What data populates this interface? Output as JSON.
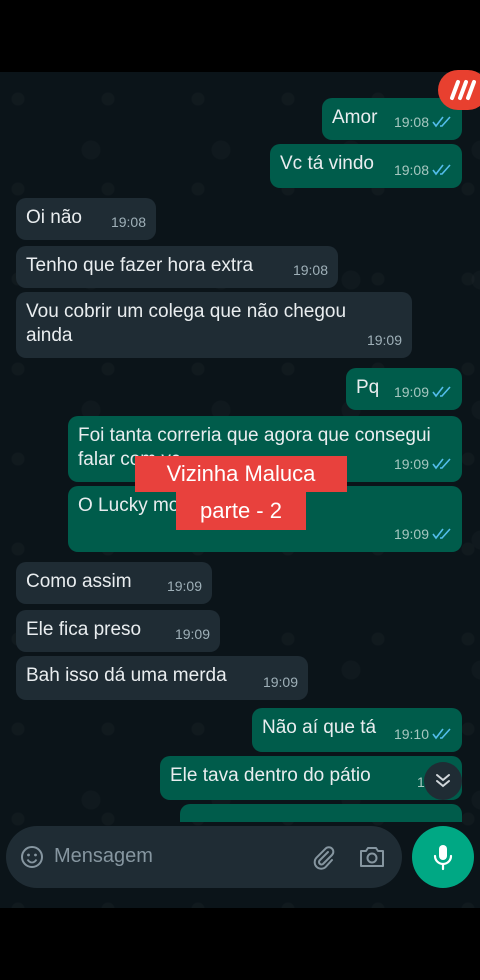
{
  "messages": [
    {
      "dir": "out",
      "text": "Amor",
      "time": "19:08"
    },
    {
      "dir": "out",
      "text": "Vc tá vindo",
      "time": "19:08"
    },
    {
      "dir": "in",
      "text": "Oi não",
      "time": "19:08"
    },
    {
      "dir": "in",
      "text": "Tenho que fazer hora extra",
      "time": "19:08"
    },
    {
      "dir": "in",
      "text": "Vou cobrir um colega que não chegou ainda",
      "time": "19:09"
    },
    {
      "dir": "out",
      "text": "Pq",
      "time": "19:09"
    },
    {
      "dir": "out",
      "text": "Foi tanta correria que agora que consegui falar com vc",
      "time": "19:09"
    },
    {
      "dir": "out",
      "text": "O Lucky mordeu a Patrícia",
      "time": "19:09"
    },
    {
      "dir": "in",
      "text": "Como assim",
      "time": "19:09"
    },
    {
      "dir": "in",
      "text": "Ele fica preso",
      "time": "19:09"
    },
    {
      "dir": "in",
      "text": "Bah isso dá uma merda",
      "time": "19:09"
    },
    {
      "dir": "out",
      "text": "Não aí que tá",
      "time": "19:10"
    },
    {
      "dir": "out",
      "text": "Ele tava dentro do pátio",
      "time": "19:10"
    }
  ],
  "overlay": {
    "title": "Vizinha Maluca",
    "subtitle": "parte - 2"
  },
  "input": {
    "placeholder": "Mensagem"
  },
  "colors": {
    "background": "#0b1419",
    "incoming_bubble": "#1f2c34",
    "outgoing_bubble": "#005c4b",
    "accent": "#00a884",
    "read_ticks": "#53bdeb",
    "overlay": "#e8413d"
  },
  "icons": [
    "emoji-icon",
    "attach-icon",
    "camera-icon",
    "mic-icon",
    "scroll-down-icon",
    "read-ticks-icon",
    "app-logo-icon"
  ]
}
